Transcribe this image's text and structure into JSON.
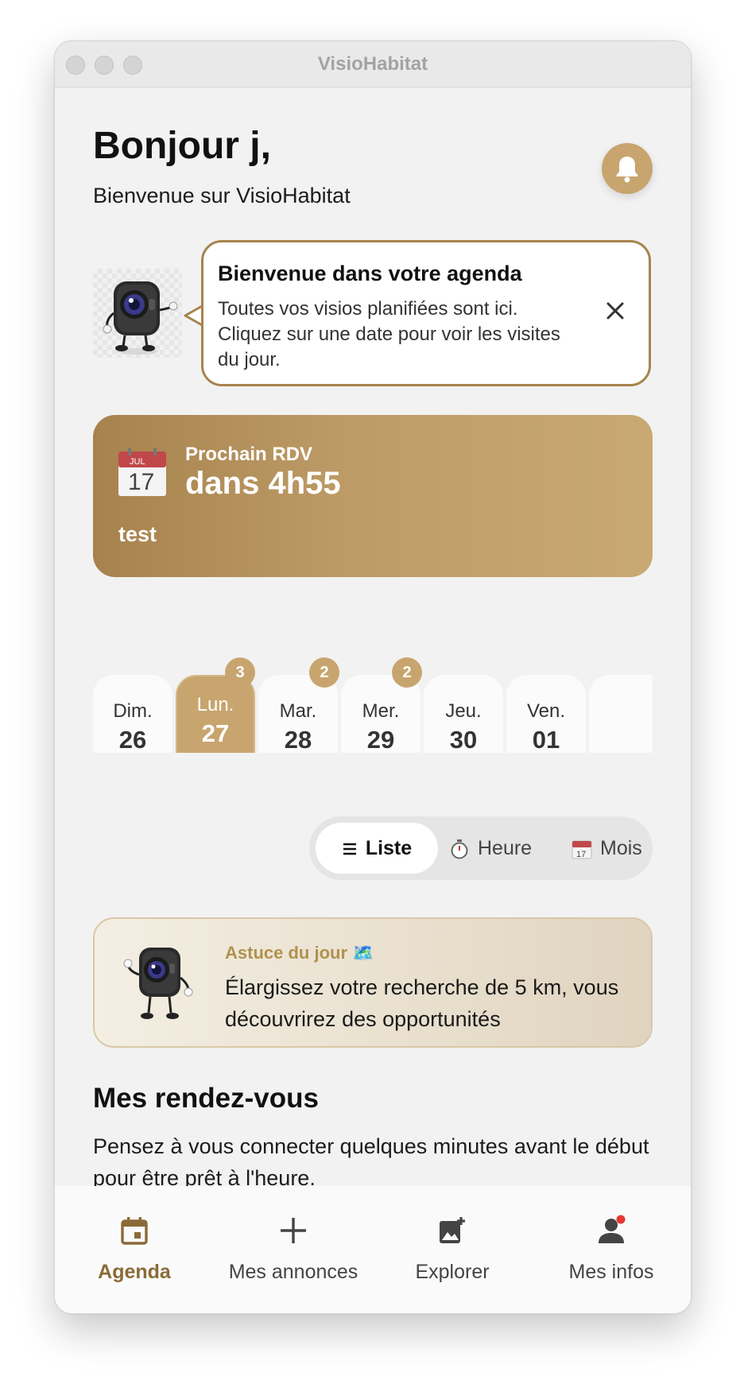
{
  "window": {
    "title": "VisioHabitat"
  },
  "header": {
    "greeting": "Bonjour j,",
    "subtitle": "Bienvenue sur VisioHabitat",
    "bell_icon": "bell-icon"
  },
  "tooltip": {
    "title": "Bienvenue dans votre agenda",
    "text": "Toutes vos visios planifiées sont ici. Cliquez sur une date pour voir les visites du jour.",
    "close_icon": "close-icon"
  },
  "next_appointment": {
    "calendar_icon": "calendar-icon",
    "calendar_month": "JUL",
    "calendar_day": "17",
    "label": "Prochain RDV",
    "time": "dans 4h55",
    "title": "test"
  },
  "days": [
    {
      "name": "Dim.",
      "num": "26",
      "badge": "",
      "selected": false
    },
    {
      "name": "Lun.",
      "num": "27",
      "badge": "3",
      "selected": true
    },
    {
      "name": "Mar.",
      "num": "28",
      "badge": "2",
      "selected": false
    },
    {
      "name": "Mer.",
      "num": "29",
      "badge": "2",
      "selected": false
    },
    {
      "name": "Jeu.",
      "num": "30",
      "badge": "",
      "selected": false
    },
    {
      "name": "Ven.",
      "num": "01",
      "badge": "",
      "selected": false
    }
  ],
  "view_toggle": {
    "list": {
      "label": "Liste",
      "icon": "list-icon",
      "active": true
    },
    "hour": {
      "label": "Heure",
      "icon": "stopwatch-icon",
      "active": false
    },
    "month": {
      "label": "Mois",
      "icon": "calendar-icon",
      "active": false
    }
  },
  "tip": {
    "label": "Astuce du jour 🗺️",
    "text": "Élargissez votre recherche de 5 km, vous découvrirez des opportunités"
  },
  "appointments": {
    "title": "Mes rendez-vous",
    "text": "Pensez à vous connecter quelques minutes avant le début pour être prêt à l'heure."
  },
  "tabbar": [
    {
      "label": "Agenda",
      "icon": "calendar-icon",
      "active": true
    },
    {
      "label": "Mes annonces",
      "icon": "plus-icon",
      "active": false
    },
    {
      "label": "Explorer",
      "icon": "add-photo-icon",
      "active": false
    },
    {
      "label": "Mes infos",
      "icon": "person-icon",
      "active": false
    }
  ],
  "colors": {
    "accent": "#c8a56f",
    "accent_dark": "#8a6a36",
    "notification_dot": "#e53935"
  }
}
